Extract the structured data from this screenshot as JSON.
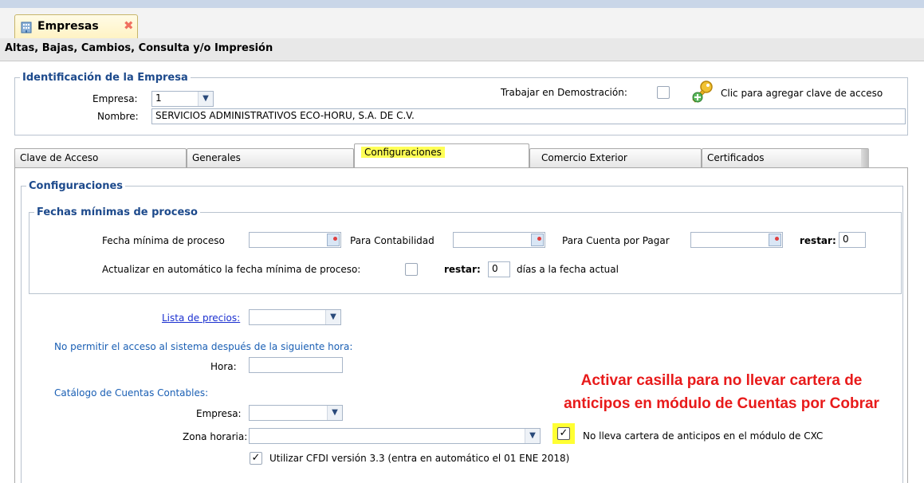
{
  "document_tab": {
    "title": "Empresas",
    "close_glyph": "✖",
    "icon": "building-icon"
  },
  "subtitle": "Altas, Bajas, Cambios, Consulta y/o Impresión",
  "identification": {
    "legend": "Identificación de la Empresa",
    "empresa_label": "Empresa:",
    "empresa_value": "1",
    "nombre_label": "Nombre:",
    "nombre_value": "SERVICIOS ADMINISTRATIVOS ECO-HORU, S.A. DE C.V.",
    "demo_label": "Trabajar en Demostración:",
    "demo_checked": false,
    "access_key_text": "Clic para agregar clave de acceso",
    "access_key_icon": "key-add-icon"
  },
  "tabs": [
    {
      "label": "Clave de Acceso",
      "active": false
    },
    {
      "label": "Generales",
      "active": false
    },
    {
      "label": "Configuraciones",
      "active": true
    },
    {
      "label": "Comercio Exterior",
      "active": false
    },
    {
      "label": "Certificados",
      "active": false
    }
  ],
  "config": {
    "legend": "Configuraciones",
    "fechas": {
      "legend": "Fechas mínimas de proceso",
      "fecha_minima_label": "Fecha mínima de proceso",
      "fecha_minima_value": "",
      "contabilidad_label": "Para Contabilidad",
      "contabilidad_value": "",
      "cxp_label": "Para Cuenta por Pagar",
      "cxp_value": "",
      "restar_label": "restar:",
      "restar_value": "0",
      "auto_label": "Actualizar en automático la fecha mínima de proceso:",
      "auto_checked": false,
      "restar2_label": "restar:",
      "restar2_value": "0",
      "dias_label": "días a la fecha actual"
    },
    "lista_precios_label": "Lista de precios:",
    "lista_precios_value": "",
    "no_permitir_label": "No permitir el acceso al sistema después de la siguiente hora:",
    "hora_label": "Hora:",
    "hora_value": "",
    "catalogo_label": "Catálogo de Cuentas Contables:",
    "empresa_label": "Empresa:",
    "empresa_value": "",
    "zona_label": "Zona horaria:",
    "zona_value": "",
    "cartera_label": "No lleva cartera de anticipos en el módulo de CXC",
    "cartera_checked": true,
    "cfdi_label": "Utilizar CFDI versión 3.3 (entra en automático el 01 ENE 2018)",
    "cfdi_checked": true
  },
  "annotation": {
    "line1": "Activar casilla para no llevar cartera de",
    "line2": "anticipos en módulo de Cuentas por Cobrar",
    "color": "#e81a1a",
    "highlight_color": "#ffff33"
  },
  "glyphs": {
    "dropdown": "▼",
    "check": "✓"
  }
}
